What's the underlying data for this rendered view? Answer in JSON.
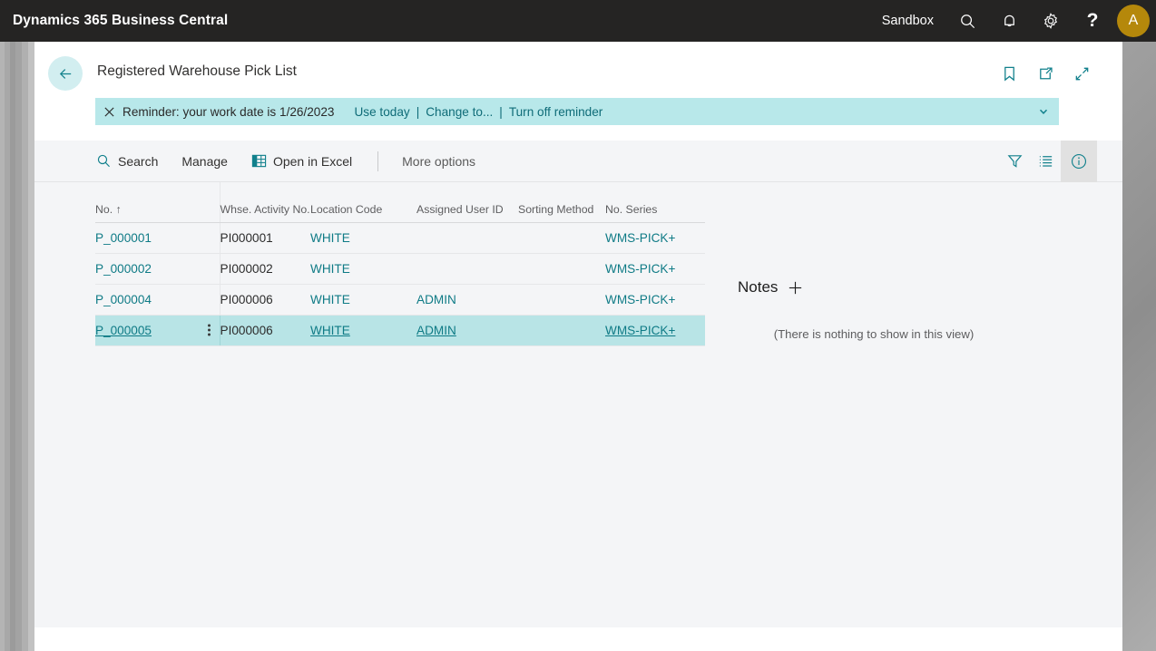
{
  "appbar": {
    "title": "Dynamics 365 Business Central",
    "environment": "Sandbox",
    "icons": [
      "search-icon",
      "notification-bell-icon",
      "settings-gear-icon",
      "help-question-icon"
    ],
    "help_label": "?",
    "avatar_initial": "A",
    "avatar_color": "#b5880b",
    "background_color": "#252423"
  },
  "page": {
    "back_label": "Back",
    "title": "Registered Warehouse Pick List",
    "header_icons": [
      "bookmark-icon",
      "open-in-new-window-icon",
      "collapse-icon"
    ]
  },
  "notification": {
    "close_label": "×",
    "message": "Reminder: your work date is 1/26/2023",
    "links": [
      "Use today",
      "Change to...",
      "Turn off reminder"
    ],
    "separator": "|",
    "expand_label": "Expand",
    "background_color": "#b8e8ea"
  },
  "toolbar": {
    "search_label": "Search",
    "manage_label": "Manage",
    "excel_label": "Open in Excel",
    "more_options_label": "More options",
    "right_icons": [
      "filter-icon",
      "list-view-icon",
      "info-icon"
    ]
  },
  "table": {
    "columns": [
      "No. ↑",
      "Whse. Activity No.",
      "Location Code",
      "Assigned User ID",
      "Sorting Method",
      "No. Series"
    ],
    "rows": [
      {
        "no": "P_000001",
        "whse_activity_no": "PI000001",
        "location_code": "WHITE",
        "assigned_user_id": "",
        "sorting_method": "",
        "no_series": "WMS-PICK+",
        "selected": false
      },
      {
        "no": "P_000002",
        "whse_activity_no": "PI000002",
        "location_code": "WHITE",
        "assigned_user_id": "",
        "sorting_method": "",
        "no_series": "WMS-PICK+",
        "selected": false
      },
      {
        "no": "P_000004",
        "whse_activity_no": "PI000006",
        "location_code": "WHITE",
        "assigned_user_id": "ADMIN",
        "sorting_method": "",
        "no_series": "WMS-PICK+",
        "selected": false
      },
      {
        "no": "P_000005",
        "whse_activity_no": "PI000006",
        "location_code": "WHITE",
        "assigned_user_id": "ADMIN",
        "sorting_method": "",
        "no_series": "WMS-PICK+",
        "selected": true
      }
    ],
    "selected_row_color": "#b8e4e6",
    "link_color": "#0f7b86"
  },
  "notes": {
    "title": "Notes",
    "add_label": "+",
    "empty_message": "(There is nothing to show in this view)"
  }
}
